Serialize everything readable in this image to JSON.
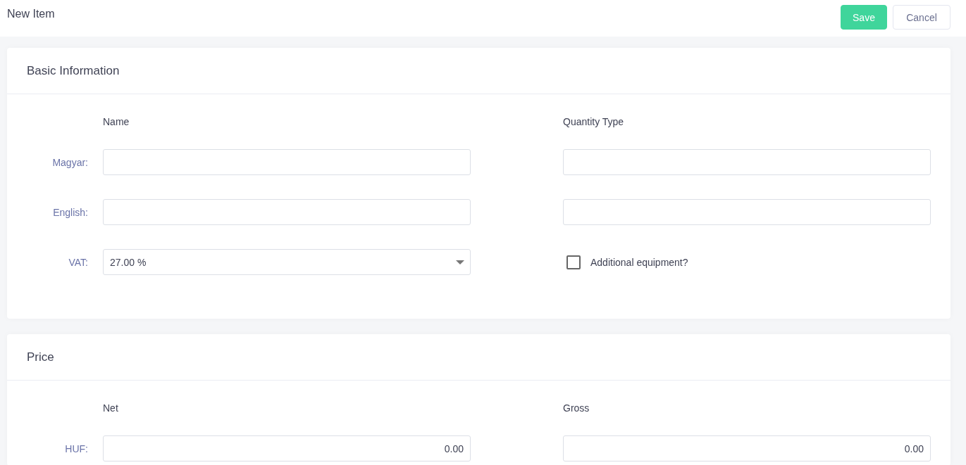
{
  "page": {
    "title": "New Item"
  },
  "actions": [
    {
      "label": "Save",
      "kind": "primary"
    },
    {
      "label": "Cancel",
      "kind": "secondary"
    }
  ],
  "sections": [
    {
      "title": "Basic Information",
      "columns": [
        "Name",
        "Quantity Type"
      ],
      "rows": [
        {
          "label": "Magyar:",
          "fields": [
            {
              "kind": "text"
            },
            {
              "kind": "text"
            }
          ]
        },
        {
          "label": "English:",
          "fields": [
            {
              "kind": "text"
            },
            {
              "kind": "text"
            }
          ]
        },
        {
          "label": "VAT:",
          "fields": [
            {
              "kind": "select",
              "value": "27.00 %"
            },
            {
              "kind": "checkbox",
              "label": "Additional equipment?",
              "checked": false
            }
          ]
        }
      ]
    },
    {
      "title": "Price",
      "columns": [
        "Net",
        "Gross"
      ],
      "rows": [
        {
          "label": "HUF:",
          "fields": [
            {
              "kind": "number",
              "value": "0.00"
            },
            {
              "kind": "number",
              "value": "0.00"
            }
          ]
        }
      ]
    }
  ]
}
